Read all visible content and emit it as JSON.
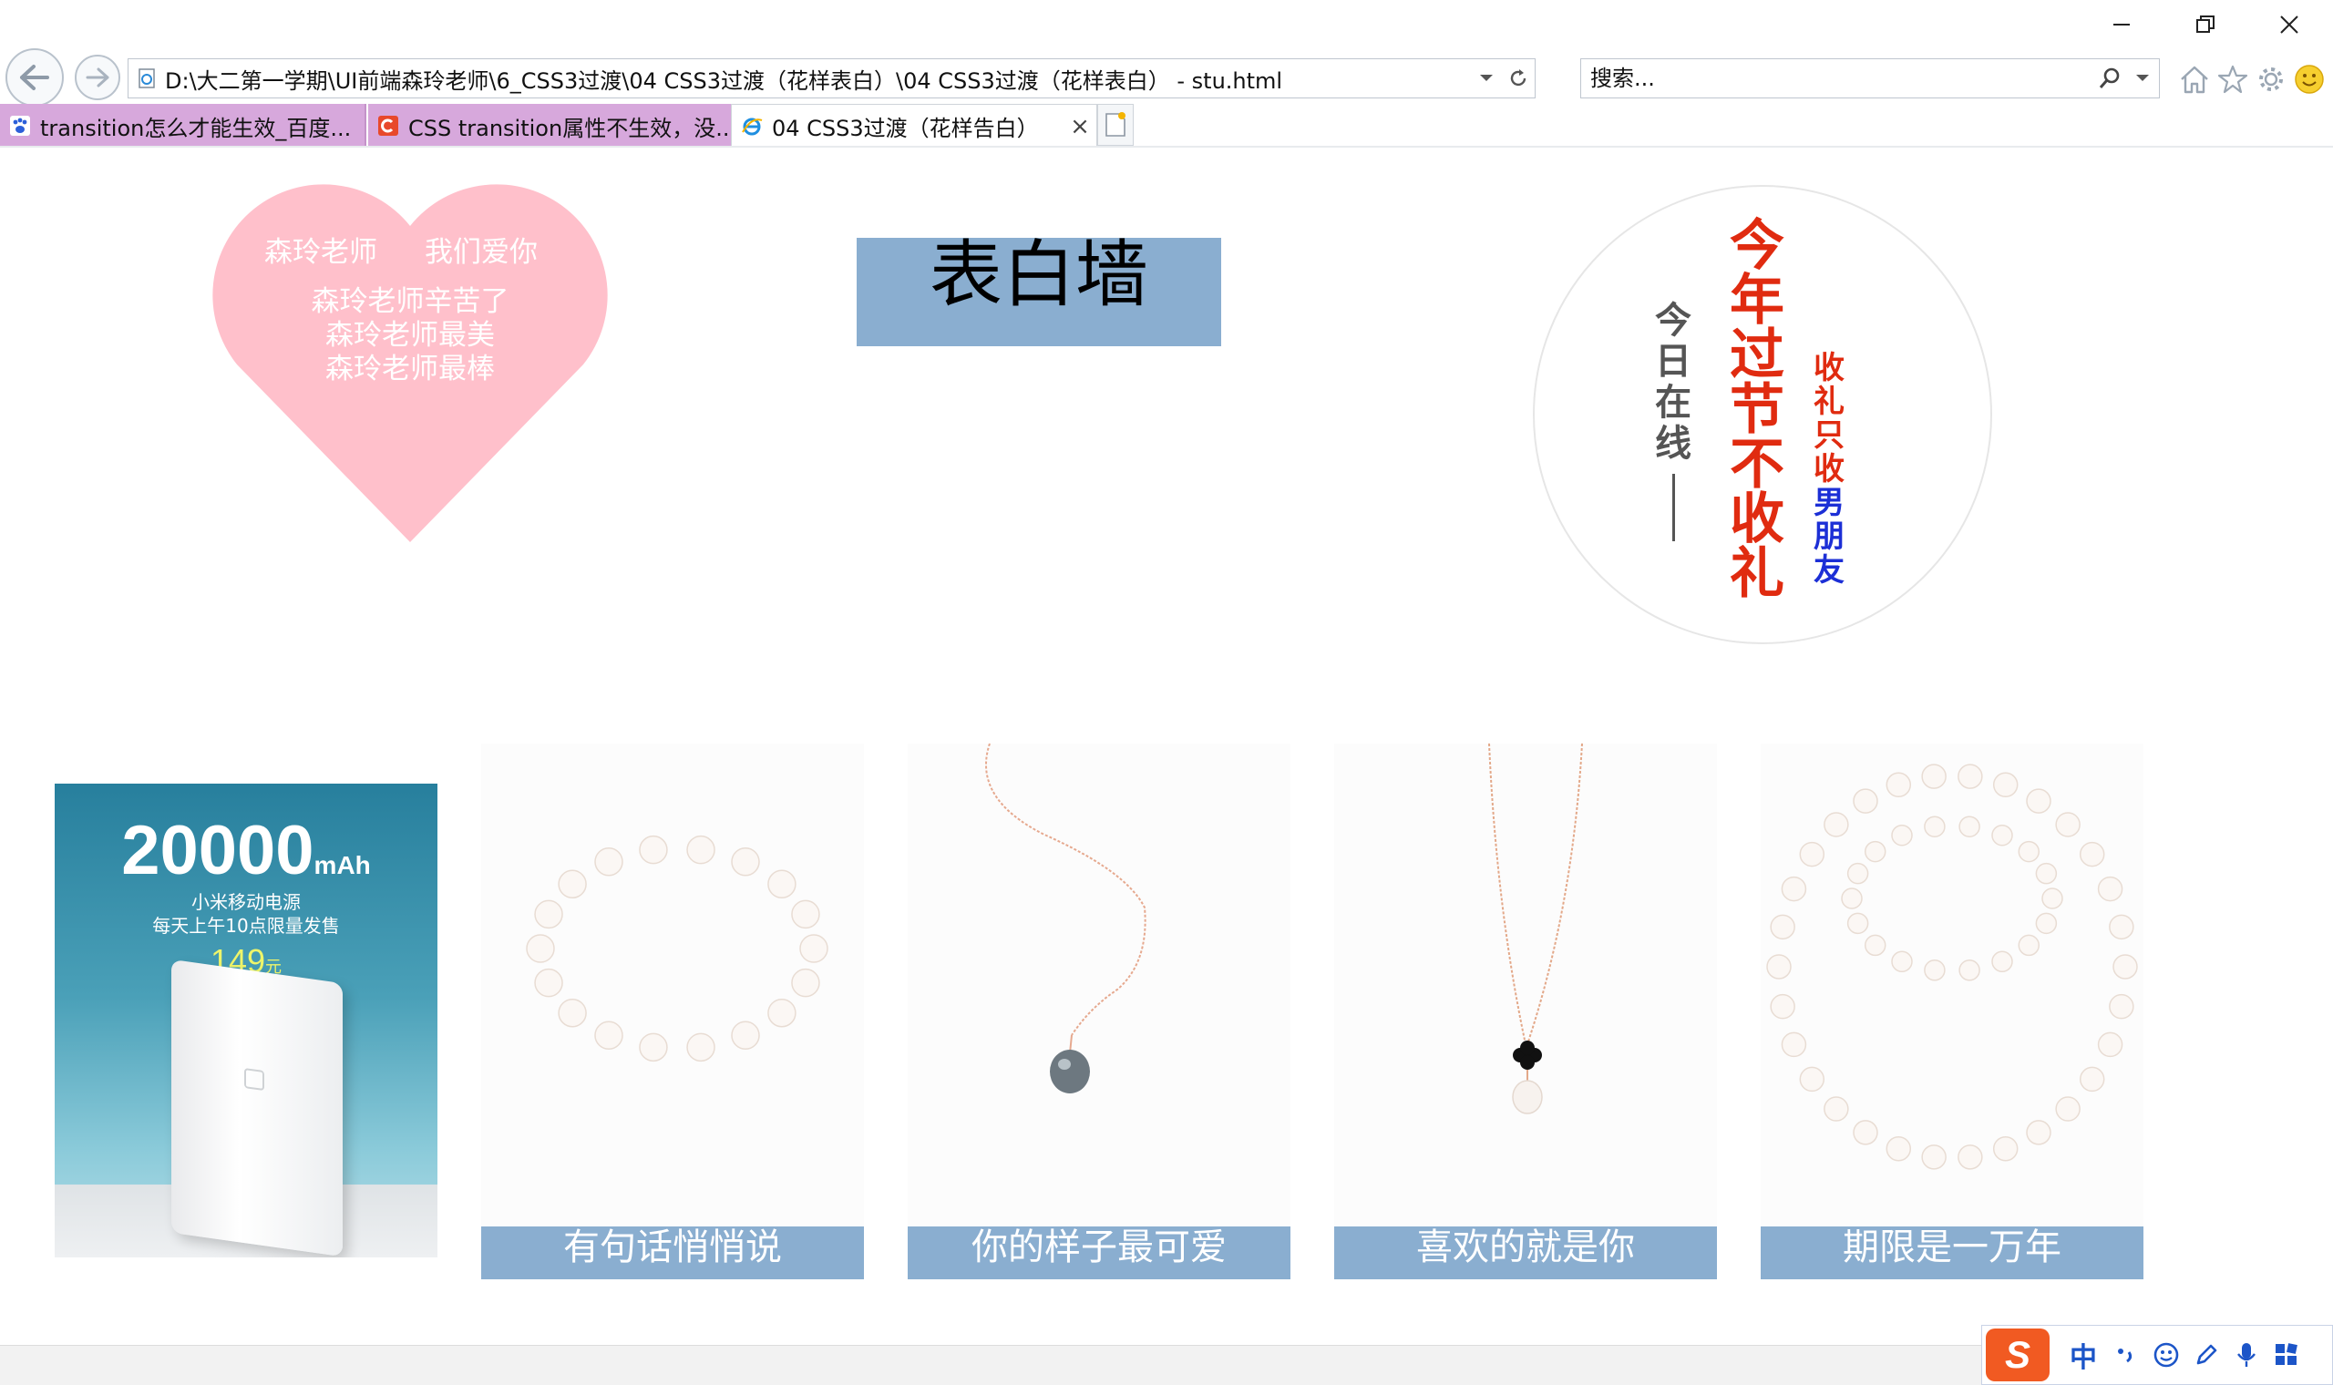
{
  "browser": {
    "address": "D:\\大二第一学期\\UI前端森玲老师\\6_CSS3过渡\\04 CSS3过渡（花样表白）\\04 CSS3过渡（花样表白）  - stu.html",
    "search_placeholder": "搜索...",
    "tabs": [
      {
        "label": "transition怎么才能生效_百度...",
        "icon": "baidu-paw-icon",
        "active": false
      },
      {
        "label": "CSS transition属性不生效，没...",
        "icon": "csdn-c-icon",
        "active": false
      },
      {
        "label": "04 CSS3过渡（花样告白）",
        "icon": "ie-logo-icon",
        "active": true
      }
    ],
    "tab_close": "×"
  },
  "page": {
    "heart": {
      "line_left": "森玲老师",
      "line_right": "我们爱你",
      "lines": [
        "森玲老师辛苦了",
        "森玲老师最美",
        "森玲老师最棒"
      ]
    },
    "wall_title": "表白墙",
    "circle_poster": {
      "gray_column": "今日在线",
      "red_column": "今年过节不收礼",
      "small_red": "收礼只收",
      "small_blue": "男朋友"
    },
    "promo": {
      "capacity": "20000",
      "unit": "mAh",
      "line1": "小米移动电源",
      "line2": "每天上午10点限量发售",
      "price": "149",
      "price_unit": "元"
    },
    "cards": [
      {
        "caption": "有句话悄悄说"
      },
      {
        "caption": "你的样子最可爱"
      },
      {
        "caption": "喜欢的就是你"
      },
      {
        "caption": "期限是一万年"
      }
    ]
  },
  "ime": {
    "logo": "S",
    "mode": "中"
  },
  "colors": {
    "heart": "#ffc0cb",
    "caption_bar": "#8aaed0",
    "poster_red": "#e02b10",
    "poster_blue": "#1c2fd6"
  }
}
